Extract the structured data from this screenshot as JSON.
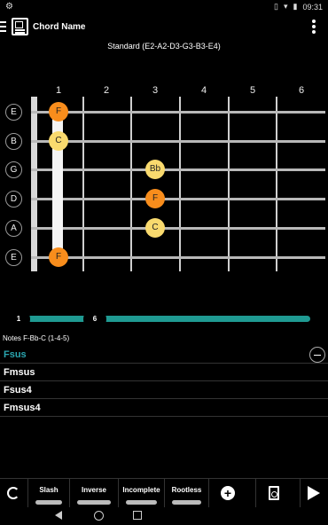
{
  "statusbar": {
    "time": "09:31"
  },
  "appbar": {
    "title": "Chord Name"
  },
  "tuning": "Standard (E2-A2-D3-G3-B3-E4)",
  "frets": [
    "1",
    "2",
    "3",
    "4",
    "5",
    "6"
  ],
  "strings": [
    "E",
    "B",
    "G",
    "D",
    "A",
    "E"
  ],
  "notes": [
    {
      "label": "F",
      "string": 0,
      "fret": 1,
      "kind": "root"
    },
    {
      "label": "C",
      "string": 1,
      "fret": 1,
      "kind": "other"
    },
    {
      "label": "Bb",
      "string": 2,
      "fret": 3,
      "kind": "other"
    },
    {
      "label": "F",
      "string": 3,
      "fret": 3,
      "kind": "root"
    },
    {
      "label": "C",
      "string": 4,
      "fret": 3,
      "kind": "other"
    },
    {
      "label": "F",
      "string": 5,
      "fret": 1,
      "kind": "root"
    }
  ],
  "range": {
    "min_label": "1",
    "max_label": "6"
  },
  "notes_info": "Notes  F-Bb-C   (1-4-5)",
  "chords": [
    "Fsus",
    "Fmsus",
    "Fsus4",
    "Fmsus4"
  ],
  "bottom_buttons": {
    "slash": "Slash",
    "inverse": "Inverse",
    "incomplete": "Incomplete",
    "rootless": "Rootless"
  },
  "colors": {
    "accent": "#2aa6b0",
    "root_note": "#f88d1c",
    "other_note": "#f9da6e",
    "slider": "#1f9a92"
  },
  "icons": [
    "menu-icon",
    "app-logo-icon",
    "overflow-menu-icon",
    "remove-circle-icon",
    "refresh-icon",
    "add-circle-icon",
    "search-page-icon",
    "play-icon"
  ]
}
